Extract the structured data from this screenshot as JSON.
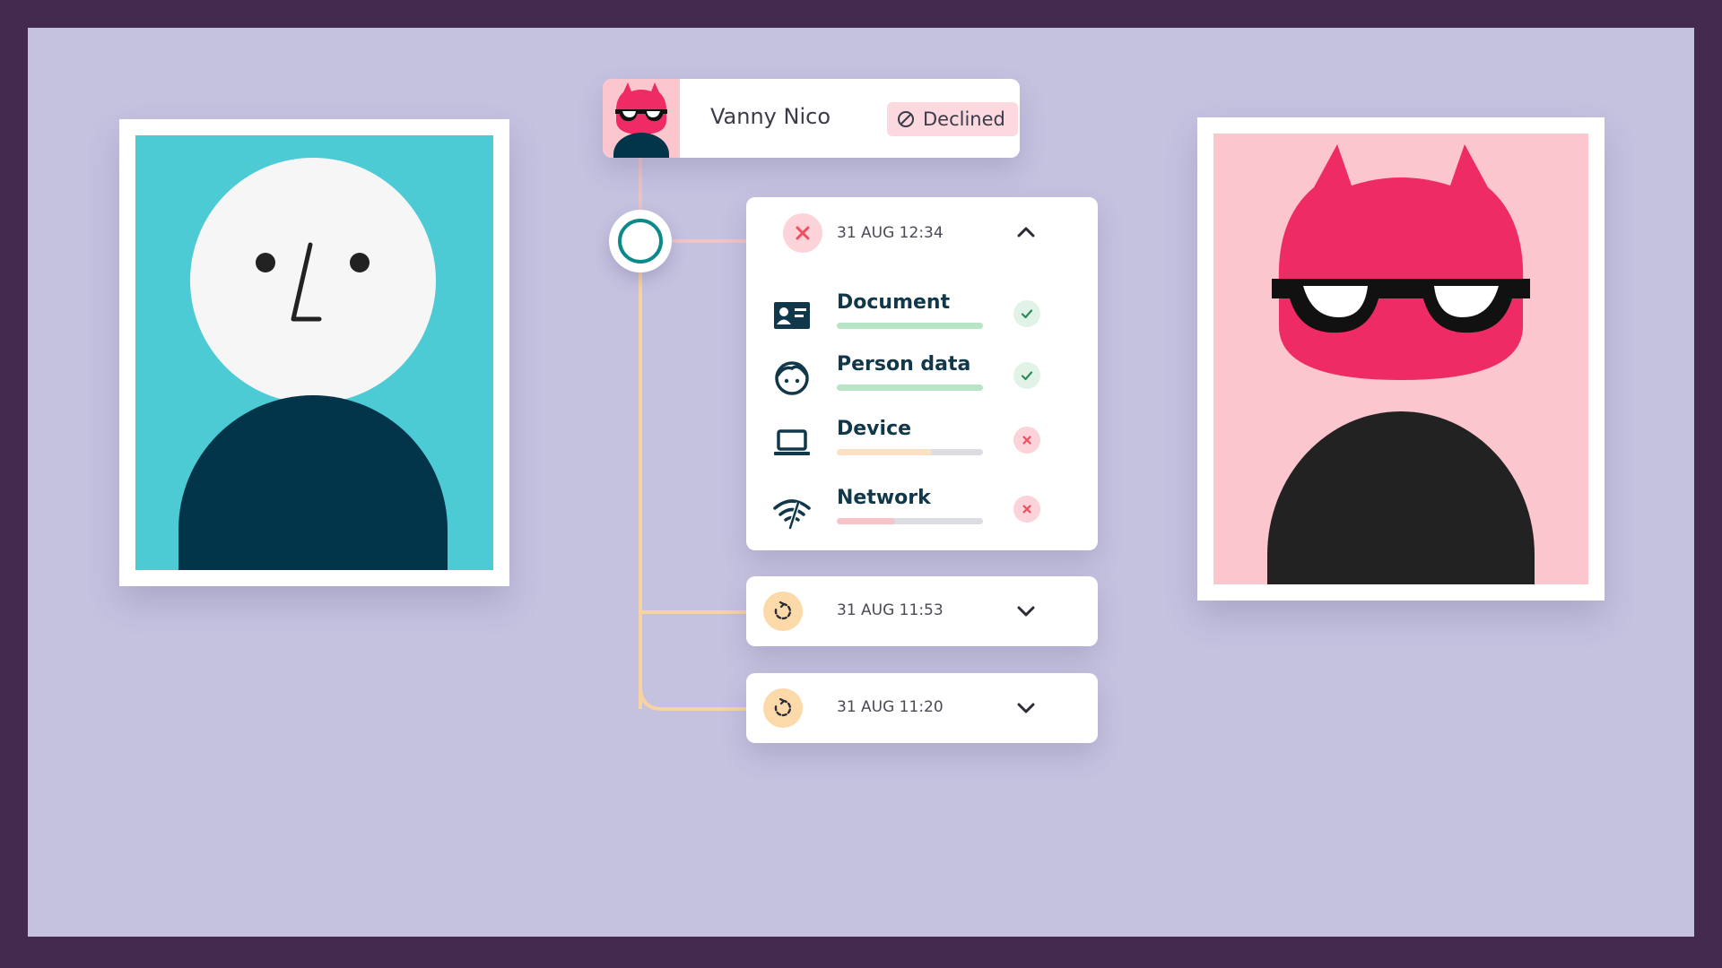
{
  "user": {
    "name": "Vanny Nico",
    "status": "Declined"
  },
  "verifications": [
    {
      "time": "31 AUG 12:34",
      "result": "failed",
      "expanded": true,
      "checks": [
        {
          "label": "Document",
          "icon": "id-card-icon",
          "progress": 1.0,
          "bar_color": "#b8e5c6",
          "status": "passed"
        },
        {
          "label": "Person data",
          "icon": "face-icon",
          "progress": 1.0,
          "bar_color": "#b8e5c6",
          "status": "passed"
        },
        {
          "label": "Device",
          "icon": "laptop-icon",
          "progress": 0.65,
          "bar_color": "#fbe1c2",
          "status": "failed"
        },
        {
          "label": "Network",
          "icon": "wifi-icon",
          "progress": 0.4,
          "bar_color": "#f6c3c8",
          "status": "failed"
        }
      ]
    },
    {
      "time": "31 AUG 11:53",
      "result": "pending",
      "expanded": false
    },
    {
      "time": "31 AUG 11:20",
      "result": "pending",
      "expanded": false
    }
  ],
  "colors": {
    "frame_bg": "#452a4f",
    "canvas_bg": "#c5c2e0",
    "teal": "#4ccbd4",
    "navy": "#02344a",
    "pink_bg": "#fbc6cd",
    "magenta": "#ee2b65",
    "badge_bg": "#fcd9de",
    "fail_dot": "#fbd3d8",
    "fail_mark": "#ef4f5f",
    "pass_dot": "#e1f3e7",
    "pass_mark": "#2f8a58",
    "pending_dot": "#fbd9a8",
    "timeline_orange": "#f7d3a1",
    "timeline_pink": "#f1c4c8"
  }
}
